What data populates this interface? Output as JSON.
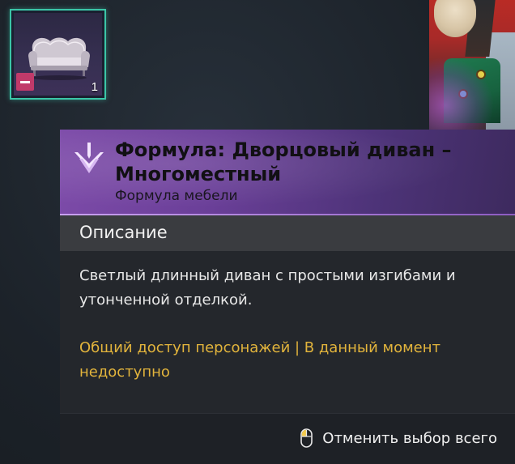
{
  "slot": {
    "item_icon": "palace-sofa-icon",
    "remove_icon": "minus-icon",
    "quantity": "1",
    "border_color": "#3bc6a8"
  },
  "tooltip": {
    "rarity_icon": "purple-chevron-rarity-icon",
    "title": "Формула: Дворцовый диван – Многоместный",
    "subtitle": "Формула мебели",
    "section_title": "Описание",
    "description": "Светлый длинный диван с простыми изгибами и утонченной отделкой.",
    "status": "Общий доступ персонажей | В данный момент недоступно",
    "header_color": "#7d4ba9",
    "status_color": "#e2b43c"
  },
  "footer": {
    "hint_icon": "mouse-left-click-icon",
    "hint_label": "Отменить выбор всего"
  }
}
